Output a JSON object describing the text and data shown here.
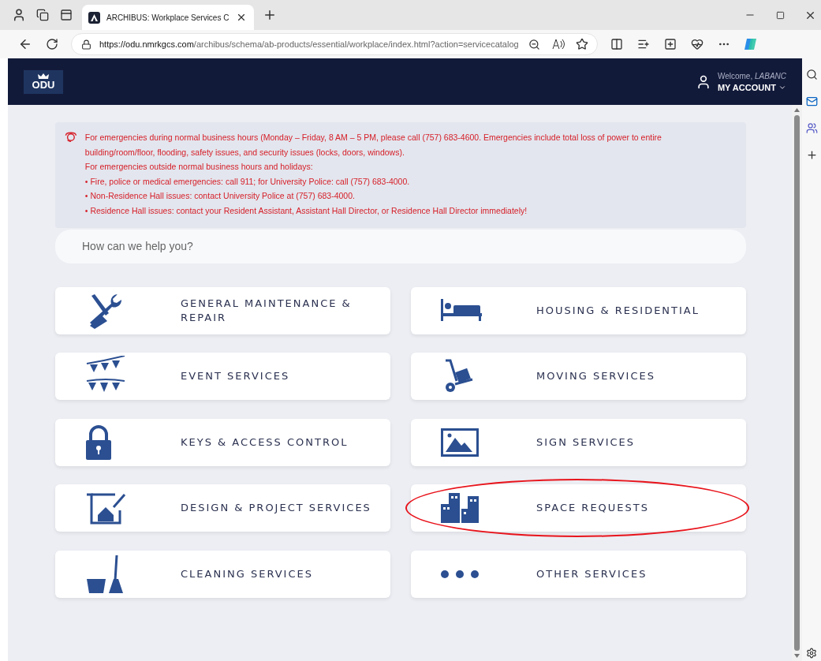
{
  "browser": {
    "tab": {
      "title": "ARCHIBUS: Workplace Services C"
    },
    "address": {
      "host": "https://odu.nmrkgcs.com",
      "path": "/archibus/schema/ab-products/essential/workplace/index.html?action=servicecatalog"
    }
  },
  "header": {
    "logo": "ODU",
    "welcome": "Welcome, *LABANC*",
    "account": "MY ACCOUNT"
  },
  "alert": {
    "lines": [
      "For emergencies during normal business hours (Monday – Friday, 8 AM – 5 PM, please call (757) 683-4600. Emergencies include total loss of power to entire building/room/floor, flooding, safety issues, and security issues (locks, doors, windows).",
      "For emergencies outside normal business hours and holidays:",
      "• Fire, police or medical emergencies: call 911; for University Police: call (757) 683-4000.",
      "• Non-Residence Hall issues: contact University Police at (757) 683-4000.",
      "• Residence Hall issues: contact your Resident Assistant, Assistant Hall Director, or Residence Hall Director immediately!"
    ]
  },
  "search": {
    "placeholder": "How can we help you?"
  },
  "services": [
    {
      "label": "GENERAL MAINTENANCE & REPAIR",
      "circled": false
    },
    {
      "label": "HOUSING & RESIDENTIAL",
      "circled": false
    },
    {
      "label": "EVENT SERVICES",
      "circled": false
    },
    {
      "label": "MOVING SERVICES",
      "circled": false
    },
    {
      "label": "KEYS & ACCESS CONTROL",
      "circled": false
    },
    {
      "label": "SIGN SERVICES",
      "circled": false
    },
    {
      "label": "DESIGN & PROJECT SERVICES",
      "circled": false
    },
    {
      "label": "SPACE REQUESTS",
      "circled": true
    },
    {
      "label": "CLEANING SERVICES",
      "circled": false
    },
    {
      "label": "OTHER SERVICES",
      "circled": false
    }
  ]
}
